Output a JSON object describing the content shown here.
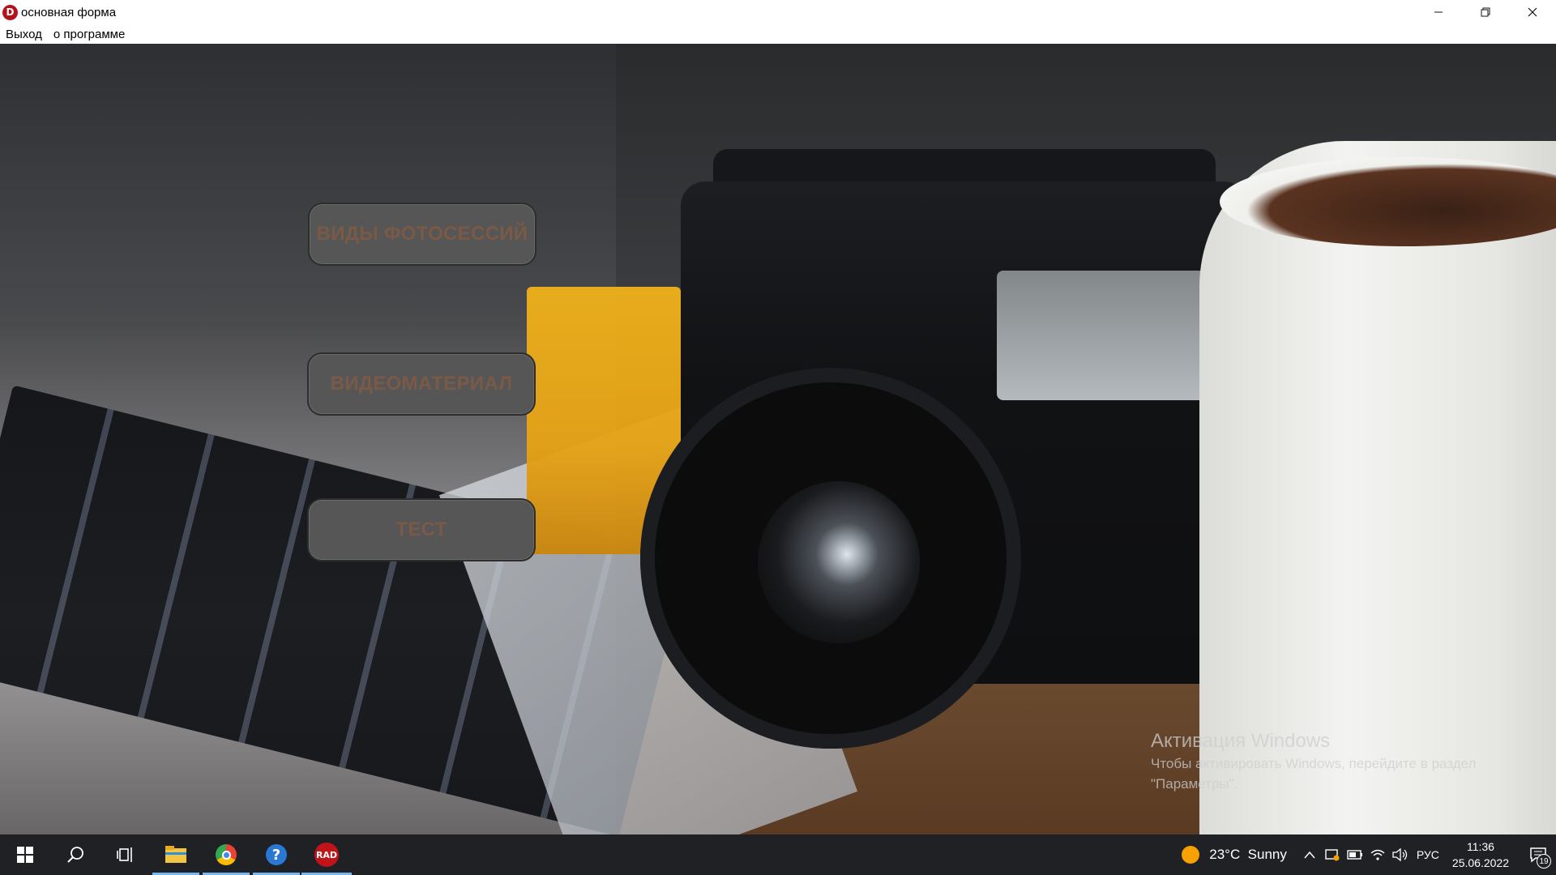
{
  "window": {
    "title": "основная форма",
    "app_icon_letter": "D",
    "controls": {
      "minimize": "minimize-icon",
      "restore": "restore-icon",
      "close": "close-icon"
    }
  },
  "menu": {
    "items": [
      {
        "label": "Выход"
      },
      {
        "label": "о программе"
      }
    ]
  },
  "buttons": [
    {
      "label": "ВИДЫ ФОТОСЕССИЙ"
    },
    {
      "label": "ВИДЕОМАТЕРИАЛ"
    },
    {
      "label": "ТЕСТ"
    }
  ],
  "watermark": {
    "title": "Активация Windows",
    "text": "Чтобы активировать Windows, перейдите в раздел \"Параметры\"."
  },
  "taskbar": {
    "apps": [
      {
        "name": "start-icon"
      },
      {
        "name": "search-icon"
      },
      {
        "name": "task-view-icon"
      },
      {
        "name": "file-explorer-icon"
      },
      {
        "name": "chrome-icon"
      },
      {
        "name": "help-icon",
        "glyph": "?"
      },
      {
        "name": "rad-studio-icon",
        "glyph": "RAD"
      }
    ],
    "weather": {
      "temp": "23°C",
      "condition": "Sunny"
    },
    "language": "РУС",
    "time": "11:36",
    "date": "25.06.2022",
    "notifications_count": "19"
  },
  "colors": {
    "button_bg": "#565656",
    "button_text": "#7a5a47",
    "taskbar_bg": "#1f2124",
    "app_icon": "#b3121b",
    "active_indicator": "#75b7f0"
  }
}
